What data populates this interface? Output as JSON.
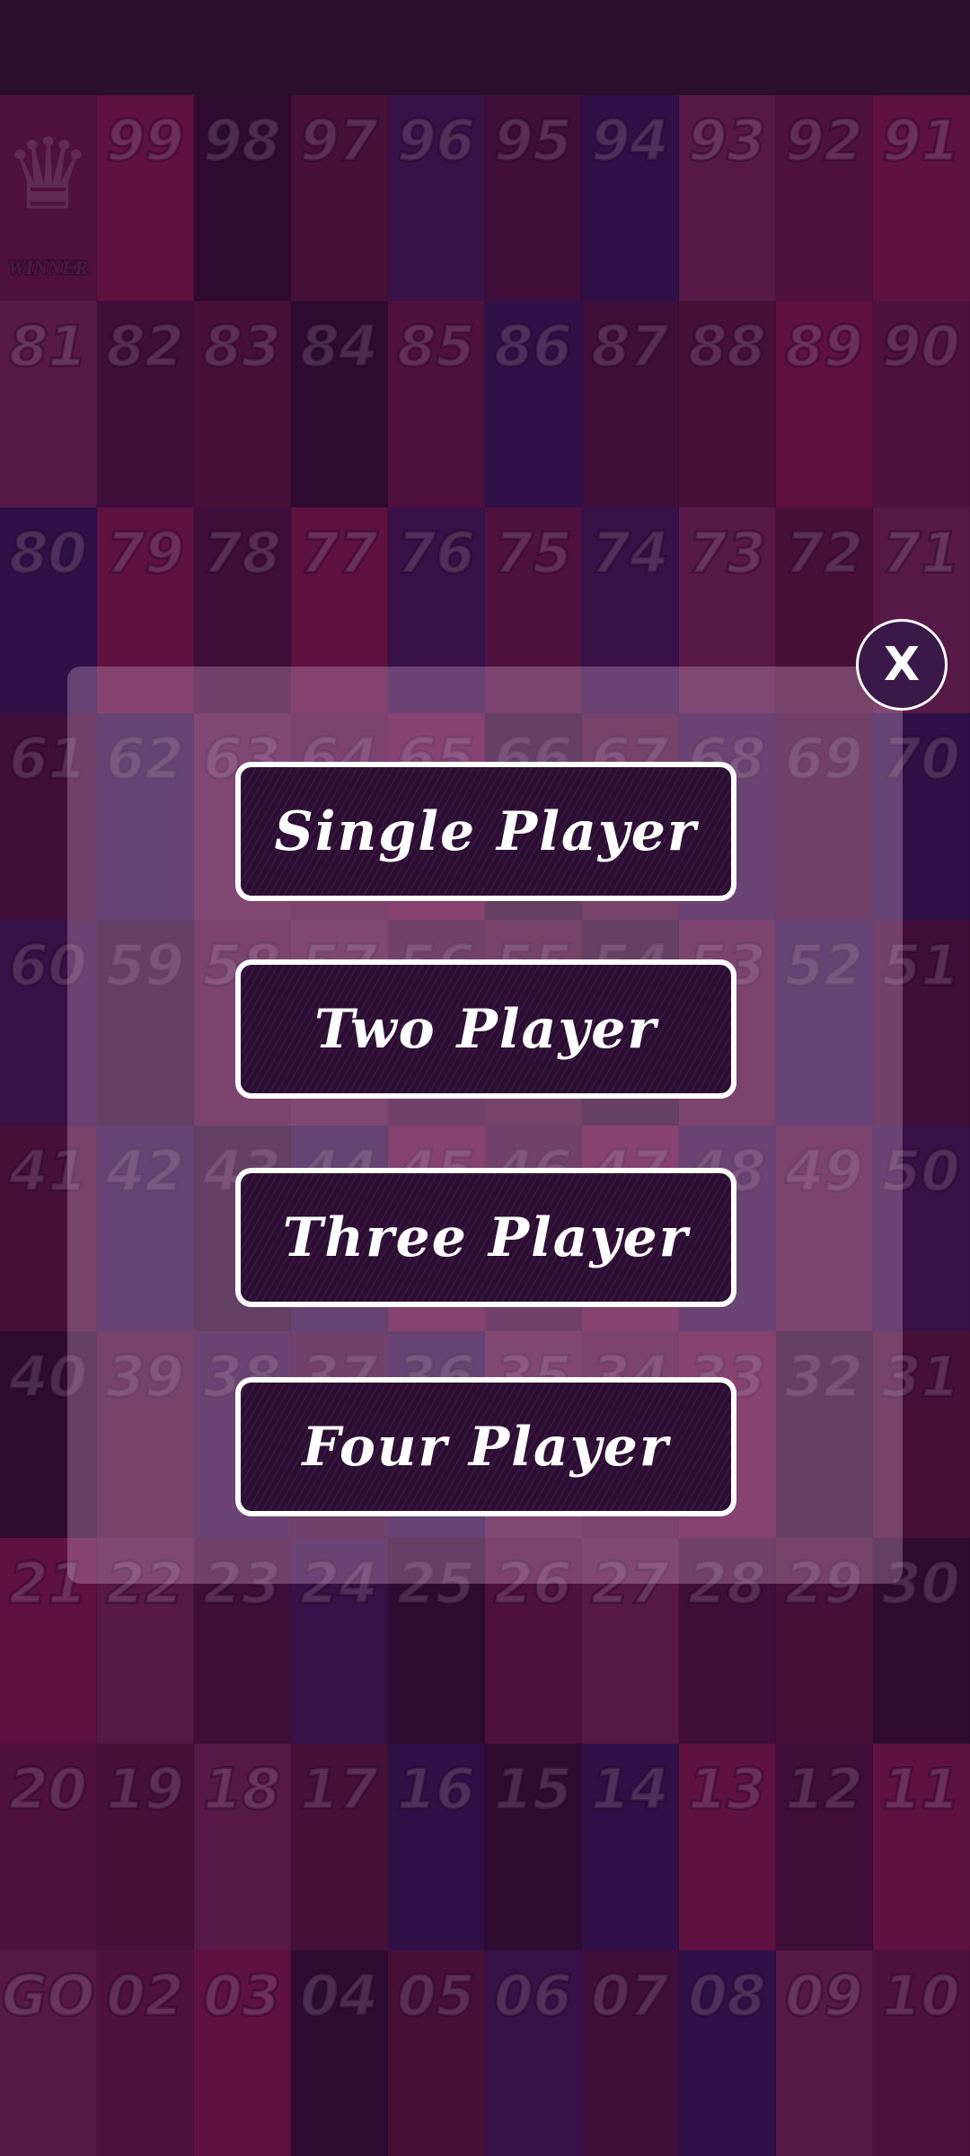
{
  "board": {
    "rows": [
      [
        "WINNER",
        "99",
        "98",
        "97",
        "96",
        "95",
        "94",
        "93",
        "92",
        "91"
      ],
      [
        "81",
        "82",
        "83",
        "84",
        "85",
        "86",
        "87",
        "88",
        "89",
        "90"
      ],
      [
        "80",
        "79",
        "78",
        "77",
        "76",
        "75",
        "74",
        "73",
        "72",
        "71"
      ],
      [
        "61",
        "62",
        "63",
        "64",
        "65",
        "66",
        "67",
        "68",
        "69",
        "70"
      ],
      [
        "60",
        "59",
        "58",
        "57",
        "56",
        "55",
        "54",
        "53",
        "52",
        "51"
      ],
      [
        "41",
        "42",
        "43",
        "44",
        "45",
        "46",
        "47",
        "48",
        "49",
        "50"
      ],
      [
        "40",
        "39",
        "38",
        "37",
        "36",
        "35",
        "34",
        "33",
        "32",
        "31"
      ],
      [
        "21",
        "22",
        "23",
        "24",
        "25",
        "26",
        "27",
        "28",
        "29",
        "30"
      ],
      [
        "20",
        "19",
        "18",
        "17",
        "16",
        "15",
        "14",
        "13",
        "12",
        "11"
      ],
      [
        "GO",
        "02",
        "03",
        "04",
        "05",
        "06",
        "07",
        "08",
        "09",
        "10"
      ]
    ],
    "cell_colors": [
      "#7a1a5a",
      "#5a1550",
      "#3a0f3f",
      "#8a2a6a",
      "#4a1a6a",
      "#9a1a5a",
      "#3a1a6a",
      "#6a1a4a"
    ]
  },
  "dialog": {
    "close_label": "X",
    "options": [
      {
        "label": "Single Player"
      },
      {
        "label": "Two Player"
      },
      {
        "label": "Three Player"
      },
      {
        "label": "Four Player"
      }
    ]
  }
}
